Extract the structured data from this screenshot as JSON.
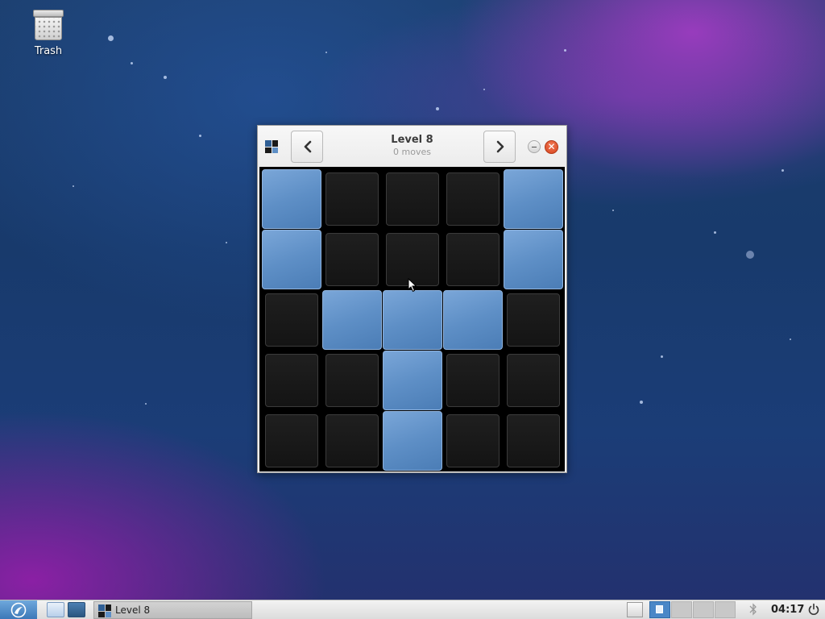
{
  "desktop": {
    "icons": [
      {
        "label": "Trash",
        "icon": "trash-icon"
      }
    ]
  },
  "window": {
    "title": "Level 8",
    "subtitle": "0 moves",
    "prev_icon": "chevron-left-icon",
    "next_icon": "chevron-right-icon",
    "minimize_icon": "minimize-icon",
    "close_icon": "close-icon",
    "close_glyph": "✕"
  },
  "game": {
    "rows": 5,
    "cols": 5,
    "grid": [
      [
        1,
        0,
        0,
        0,
        1
      ],
      [
        1,
        0,
        0,
        0,
        1
      ],
      [
        0,
        1,
        1,
        1,
        0
      ],
      [
        0,
        0,
        1,
        0,
        0
      ],
      [
        0,
        0,
        1,
        0,
        0
      ]
    ],
    "colors": {
      "lit": "#5e8fc6",
      "unlit": "#1a1a1a",
      "background": "#000000"
    }
  },
  "taskbar": {
    "task_label": "Level 8",
    "clock": "04:17",
    "workspaces": 4,
    "active_workspace": 1
  }
}
